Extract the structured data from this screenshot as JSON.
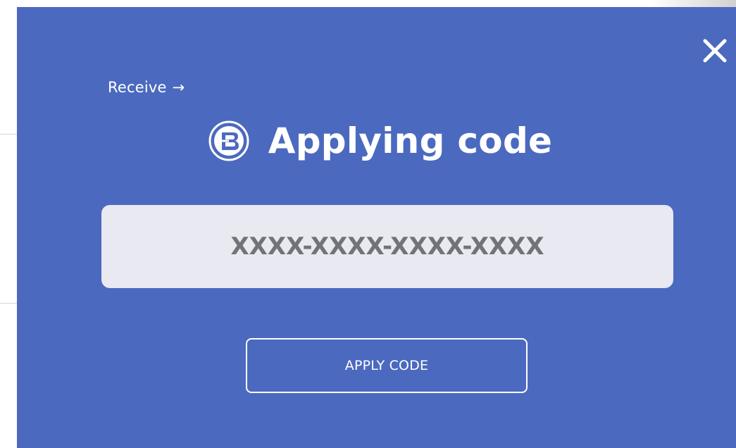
{
  "modal": {
    "receive_link": "Receive",
    "receive_arrow": "→",
    "title": "Applying code",
    "code_input": {
      "value": "",
      "placeholder": "XXXX-XXXX-XXXX-XXXX"
    },
    "apply_button": "APPLY CODE",
    "close_icon": "close-icon",
    "logo_icon": "brand-logo-icon"
  },
  "colors": {
    "modal_background": "#4b69bf",
    "input_background": "#e8e9f1",
    "text_primary": "#ffffff",
    "placeholder_text": "#727277"
  }
}
